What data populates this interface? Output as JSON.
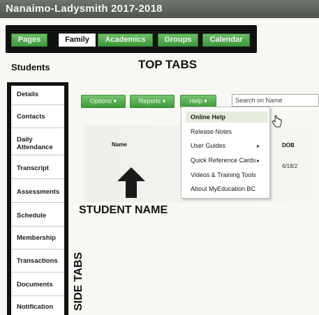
{
  "window": {
    "title": "Nanaimo-Ladysmith 2017-2018"
  },
  "top_tabs": [
    "Pages",
    "Family",
    "Academics",
    "Groups",
    "Calendar"
  ],
  "active_top_tab": "Family",
  "students_heading": "Students",
  "annotations": {
    "top_tabs": "TOP TABS",
    "student_name": "STUDENT NAME",
    "side_tabs": "SIDE TABS"
  },
  "side_tabs": [
    "Details",
    "Contacts",
    "Daily Attendance",
    "Transcript",
    "Assessments",
    "Schedule",
    "Membership",
    "Transactions",
    "Documents",
    "Notification"
  ],
  "toolbar": {
    "options_label": "Options ▾",
    "reports_label": "Reports ▾",
    "help_label": "Help ▾",
    "search_placeholder": "Search on Name"
  },
  "help_menu": [
    {
      "label": "Online Help",
      "selected": true,
      "submenu": false
    },
    {
      "label": "Release Notes",
      "selected": false,
      "submenu": false
    },
    {
      "label": "User Guides",
      "selected": false,
      "submenu": true
    },
    {
      "label": "Quick Reference Cards",
      "selected": false,
      "submenu": true
    },
    {
      "label": "Videos & Training Tools",
      "selected": false,
      "submenu": false
    },
    {
      "label": "About MyEducation BC",
      "selected": false,
      "submenu": false
    }
  ],
  "table": {
    "columns": [
      "Name",
      "DOB"
    ],
    "dob_value": "6/18/2"
  },
  "colors": {
    "tab_green": "#4aa646",
    "frame_black": "#111111",
    "title_bar": "#5c6159"
  }
}
